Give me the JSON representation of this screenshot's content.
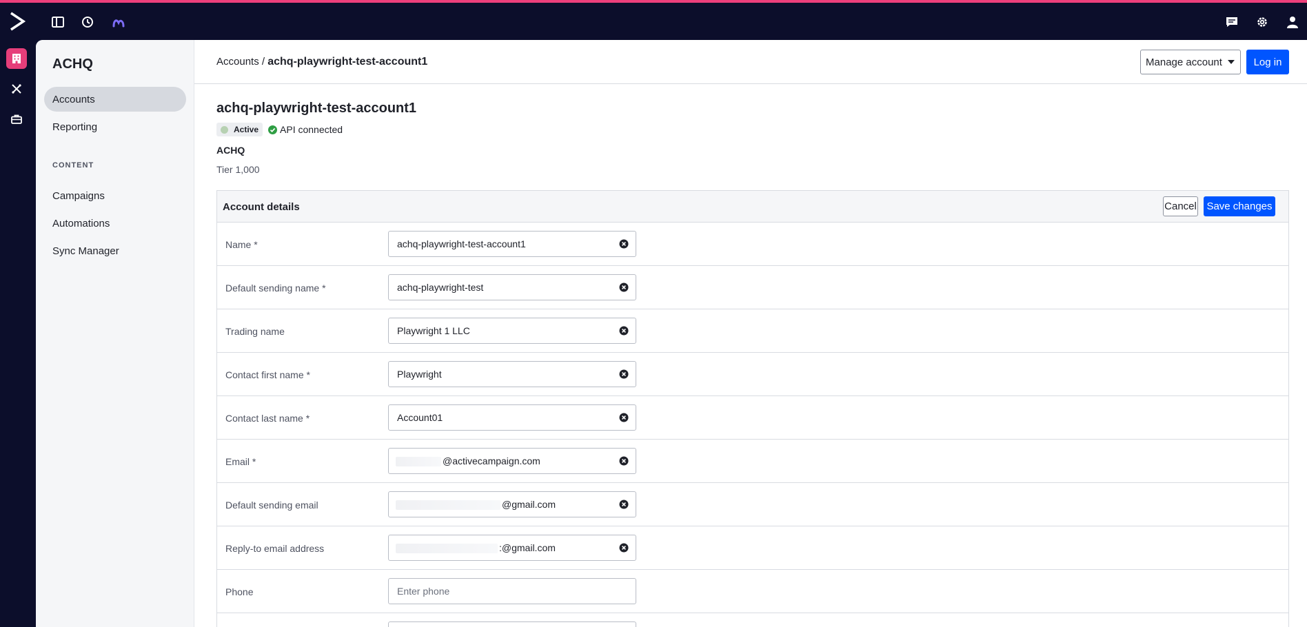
{
  "app": {
    "title": "ACHQ"
  },
  "sidebar": {
    "items": [
      {
        "label": "Accounts",
        "selected": true
      },
      {
        "label": "Reporting"
      }
    ],
    "section_label": "CONTENT",
    "content_items": [
      {
        "label": "Campaigns"
      },
      {
        "label": "Automations"
      },
      {
        "label": "Sync Manager"
      }
    ]
  },
  "header": {
    "breadcrumb_root": "Accounts",
    "breadcrumb_sep": " / ",
    "breadcrumb_current": "achq-playwright-test-account1",
    "manage_label": "Manage account",
    "login_label": "Log in"
  },
  "account": {
    "title": "achq-playwright-test-account1",
    "status": "Active",
    "api_status": "API connected",
    "org": "ACHQ",
    "tier": "Tier 1,000"
  },
  "details": {
    "title": "Account details",
    "cancel_label": "Cancel",
    "save_label": "Save changes",
    "fields": [
      {
        "label": "Name *",
        "value": "achq-playwright-test-account1"
      },
      {
        "label": "Default sending name *",
        "value": "achq-playwright-test"
      },
      {
        "label": "Trading name",
        "value": "Playwright 1 LLC"
      },
      {
        "label": "Contact first name *",
        "value": "Playwright"
      },
      {
        "label": "Contact last name *",
        "value": "Account01"
      },
      {
        "label": "Email *",
        "value": "@activecampaign.com"
      },
      {
        "label": "Default sending email",
        "value": "@gmail.com"
      },
      {
        "label": "Reply-to email address",
        "value": ":@gmail.com"
      },
      {
        "label": "Phone",
        "value": "",
        "placeholder": "Enter phone"
      }
    ]
  },
  "colors": {
    "accent": "#0055ff",
    "brand_pink": "#ed3f7b",
    "nav_dark": "#0c0e2b",
    "success": "#2f9e44"
  },
  "icons": {
    "logo": "activecampaign-chevron-logo",
    "top": [
      "sidebar-toggle-icon",
      "history-icon",
      "ai-spark-icon",
      "chat-icon",
      "gear-icon",
      "user-icon"
    ],
    "rail": [
      "building-icon",
      "tools-icon",
      "briefcase-icon"
    ]
  }
}
